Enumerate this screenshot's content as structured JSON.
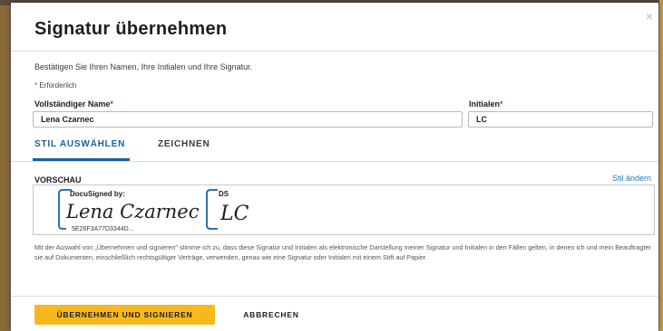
{
  "dialog": {
    "title": "Signatur übernehmen",
    "close_glyph": "×",
    "instruction": "Bestätigen Sie Ihren Namen, Ihre Initialen und Ihre Signatur.",
    "required_marker": "*",
    "required_note": " Erforderlich"
  },
  "form": {
    "full_name_label": "Vollständiger Name",
    "full_name_value": "Lena Czarnec",
    "initials_label": "Initialen",
    "initials_value": "LC",
    "required_star": "*"
  },
  "tabs": [
    {
      "label": "STIL AUSWÄHLEN",
      "active": true
    },
    {
      "label": "ZEICHNEN",
      "active": false
    }
  ],
  "preview": {
    "label": "VORSCHAU",
    "change_style_link": "Stil ändern",
    "signature_header": "DocuSigned by:",
    "signature_text": "Lena Czarnec",
    "signature_id": "5E26F3A77D3344D...",
    "initials_header": "DS",
    "initials_text": "LC"
  },
  "disclaimer": "Mit der Auswahl von „Übernehmen und signieren\" stimme ich zu, dass diese Signatur und Initialen als elektronische Darstellung meiner Signatur und Initialen in den Fällen gelten, in denen ich und mein Beauftragter sie auf Dokumenten, einschließlich rechtsgültiger Verträge, verwenden, genau wie eine Signatur oder Initialen mit einem Stift auf Papier.",
  "buttons": {
    "adopt_and_sign": "ÜBERNEHMEN UND SIGNIEREN",
    "cancel": "ABBRECHEN"
  },
  "colors": {
    "accent_blue": "#1a5fa8",
    "primary_button": "#f6b81c",
    "required_red": "#c0392b",
    "link_blue": "#1a7bbf"
  },
  "icons": {
    "close": "close-icon"
  }
}
